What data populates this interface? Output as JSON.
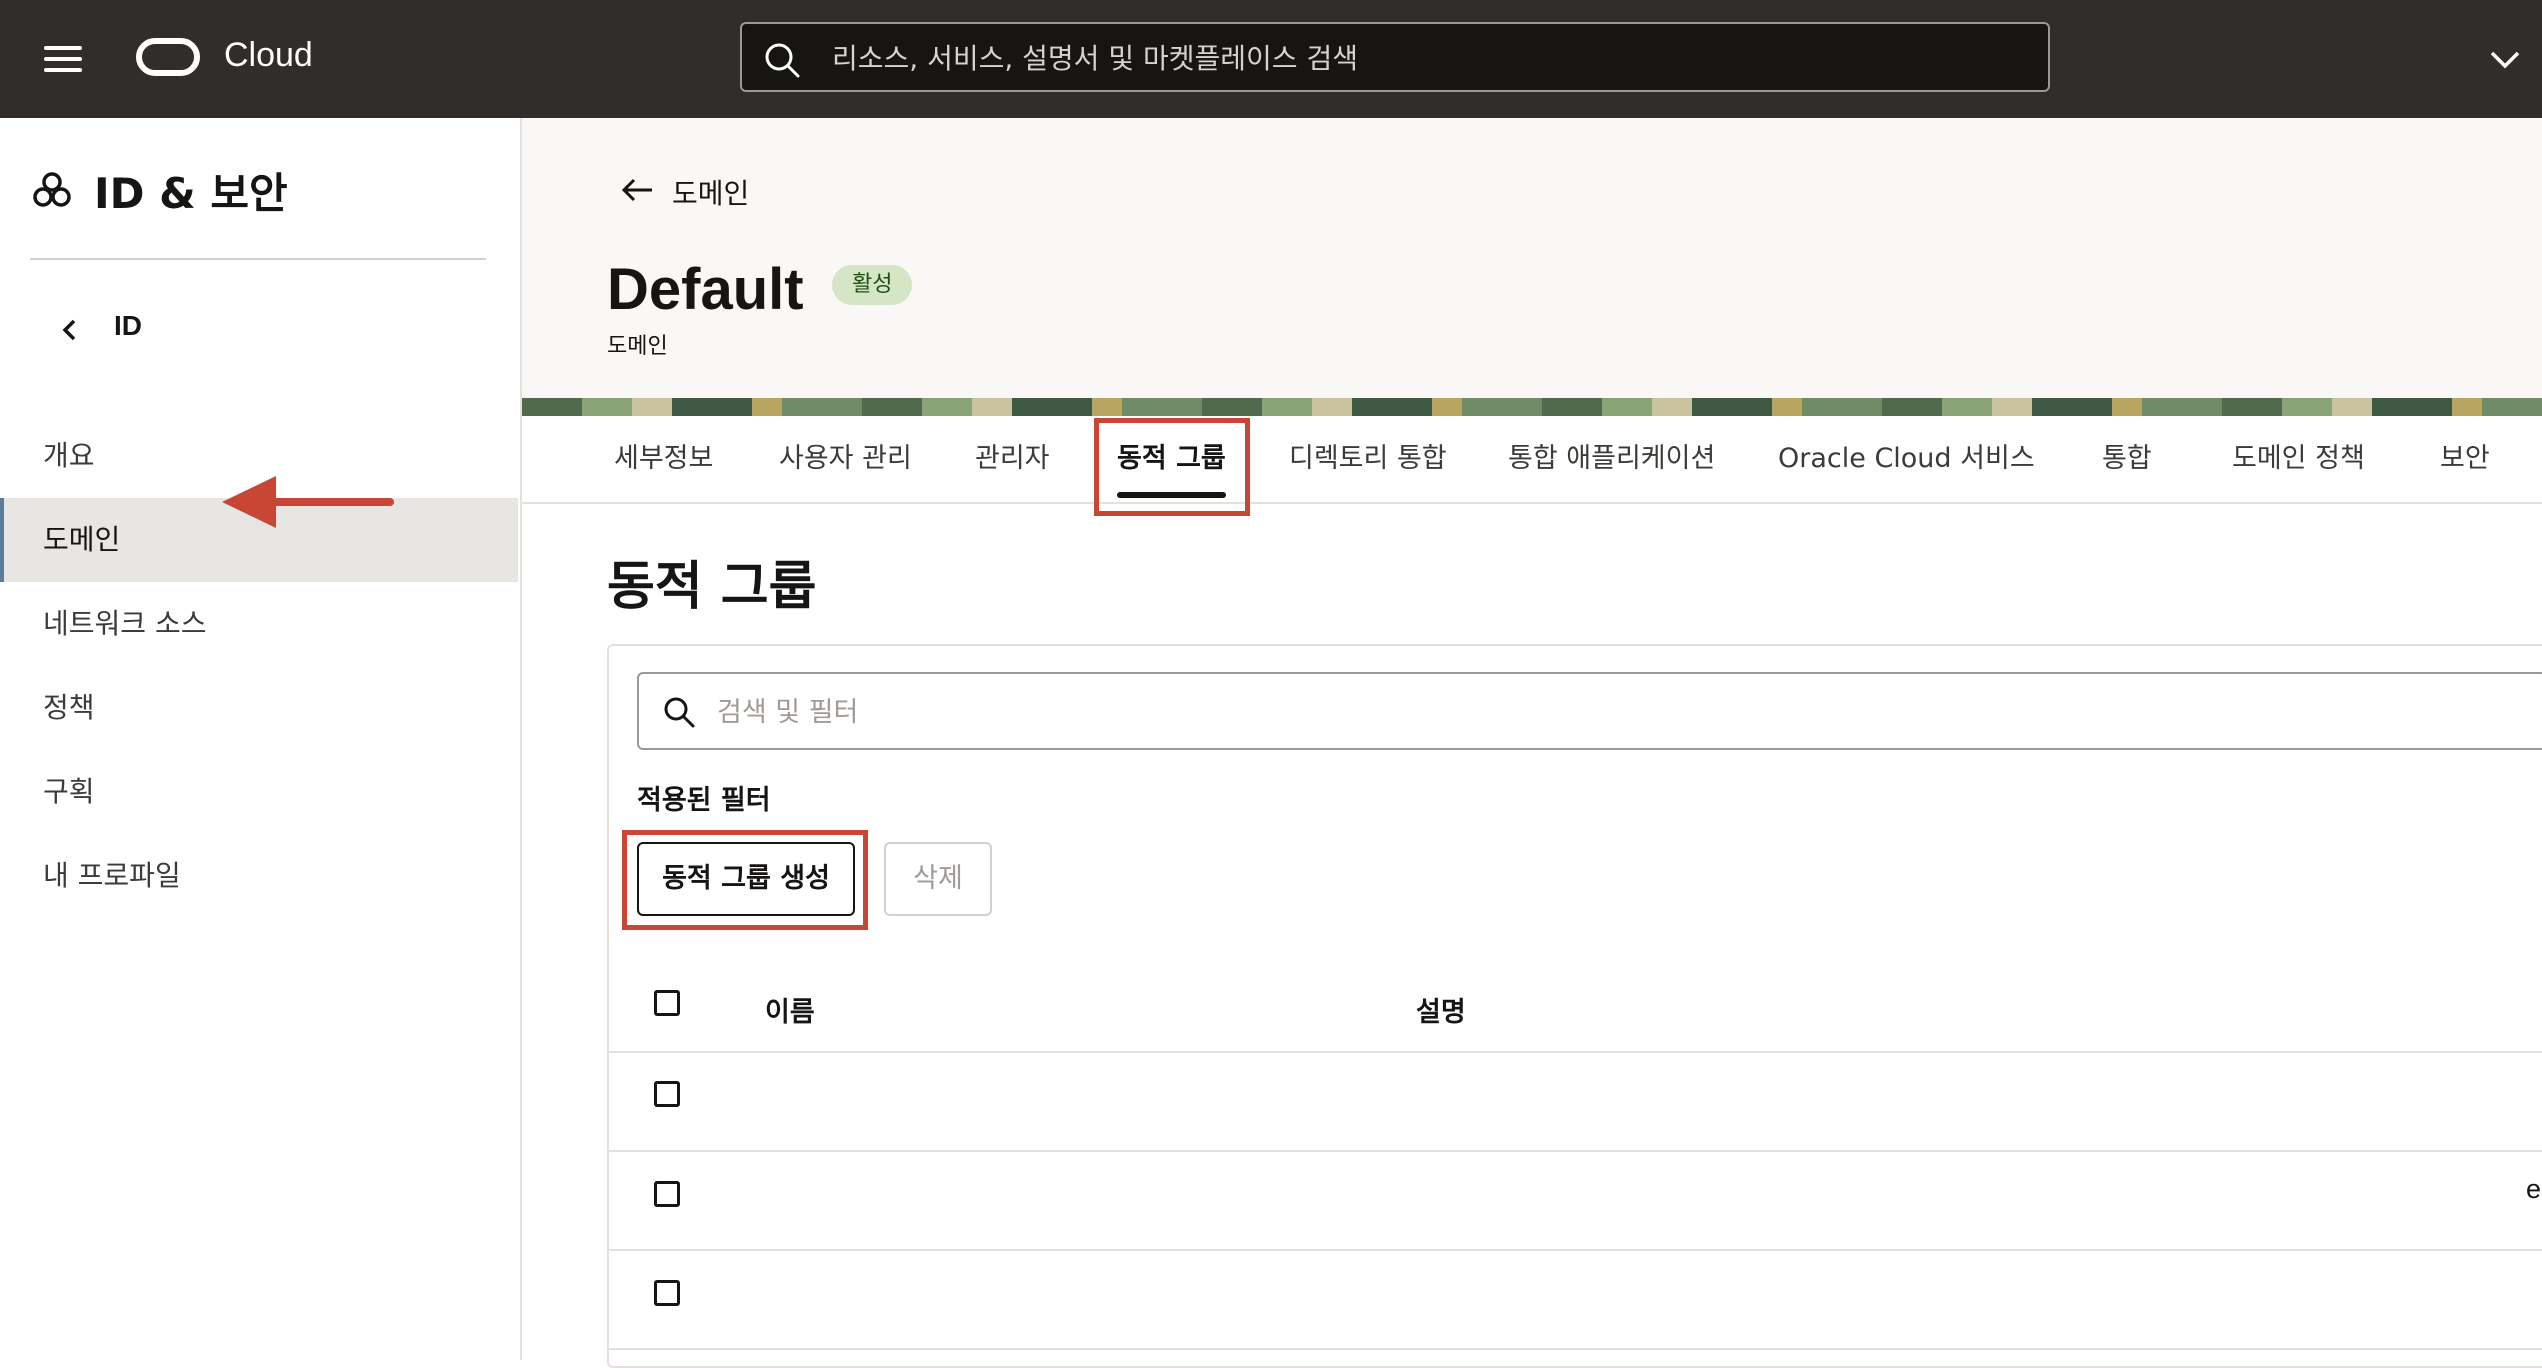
{
  "topbar": {
    "brand": "Cloud",
    "search_placeholder": "리소스, 서비스, 설명서 및 마켓플레이스 검색"
  },
  "sidebar": {
    "title": "ID & 보안",
    "back_label": "ID",
    "items": [
      {
        "label": "개요",
        "active": false
      },
      {
        "label": "도메인",
        "active": true
      },
      {
        "label": "네트워크 소스",
        "active": false
      },
      {
        "label": "정책",
        "active": false
      },
      {
        "label": "구획",
        "active": false
      },
      {
        "label": "내 프로파일",
        "active": false
      }
    ]
  },
  "header": {
    "back_label": "도메인",
    "title": "Default",
    "status_badge": "활성",
    "subtitle": "도메인"
  },
  "tabs": [
    {
      "label": "세부정보"
    },
    {
      "label": "사용자 관리"
    },
    {
      "label": "관리자"
    },
    {
      "label": "동적 그룹",
      "active": true
    },
    {
      "label": "디렉토리 통합"
    },
    {
      "label": "통합 애플리케이션"
    },
    {
      "label": "Oracle Cloud 서비스"
    },
    {
      "label": "통합"
    },
    {
      "label": "도메인 정책"
    },
    {
      "label": "보안"
    }
  ],
  "section": {
    "title": "동적 그룹",
    "filter_placeholder": "검색 및 필터",
    "applied_filters_label": "적용된 필터",
    "create_button": "동적 그룹 생성",
    "delete_button": "삭제"
  },
  "table": {
    "columns": [
      "이름",
      "설명"
    ],
    "rows": [
      {
        "name": "",
        "description": ""
      },
      {
        "name": "",
        "description": "e"
      },
      {
        "name": "",
        "description": ""
      }
    ]
  },
  "colors": {
    "topbar": "#312d2a",
    "annotation": "#c74634",
    "badge_bg": "#d4e6c6"
  }
}
